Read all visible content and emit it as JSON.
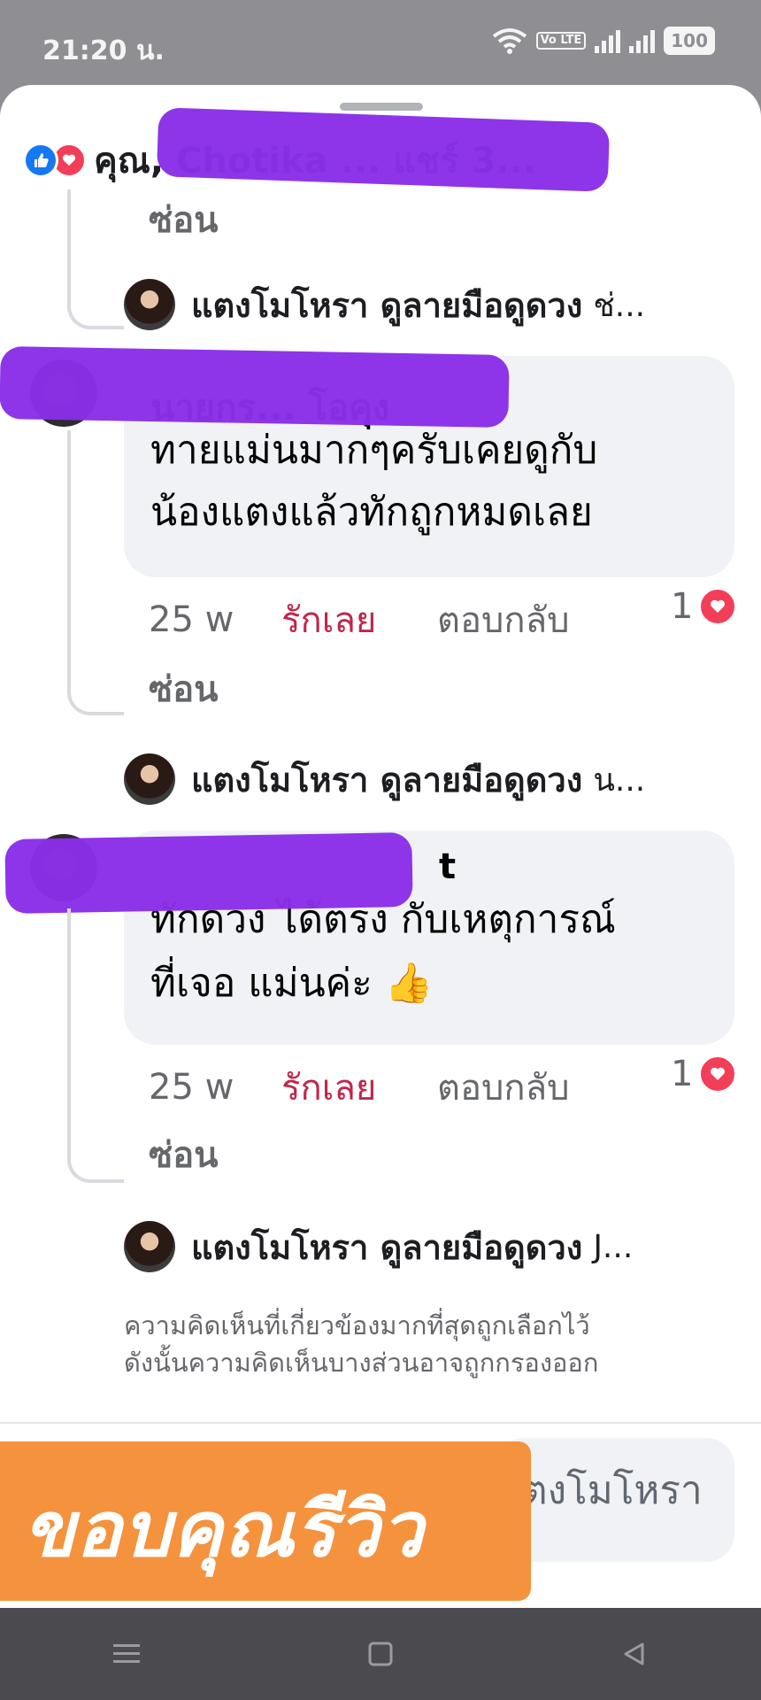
{
  "status": {
    "time": "21:20 น.",
    "network_label": "Vo LTE",
    "battery": "100"
  },
  "header": {
    "reactors_text": "คุณ, Chotika ... แชร์ 3..."
  },
  "thread": {
    "hide_label": "ซ่อน",
    "replies": [
      {
        "name": "แตงโมโหรา ดูลายมือดูดวง",
        "snippet": "ช่..."
      },
      {
        "name": "แตงโมโหรา ดูลายมือดูดวง",
        "snippet": "น..."
      },
      {
        "name": "แตงโมโหรา ดูลายมือดูดวง",
        "snippet": "J..."
      }
    ],
    "comments": [
      {
        "author": "นายกร... โอคุง",
        "line1": "ทายแม่นมากๆครับเคยดูกับ",
        "line2": "น้องแตงแล้วทักถูกหมดเลย",
        "time": "25 w",
        "love_label": "รักเลย",
        "reply_label": "ตอบกลับ",
        "reaction_count": "1"
      },
      {
        "author": "t",
        "line1": "ทักดวง ได้ตรง กับเหตุการณ์",
        "line2": "ที่เจอ แม่นค่ะ 👍",
        "time": "25 w",
        "love_label": "รักเลย",
        "reply_label": "ตอบกลับ",
        "reaction_count": "1"
      }
    ]
  },
  "footnote": {
    "line1": "ความคิดเห็นที่เกี่ยวข้องมากที่สุดถูกเลือกไว้",
    "line2": "ดังนั้นความคิดเห็นบางส่วนอาจถูกกรองออก"
  },
  "composer": {
    "partial_text": "ตงโมโหรา"
  },
  "overlay": {
    "banner_text": "ขอบคุณรีวิว"
  },
  "colors": {
    "like_blue": "#1877f2",
    "love_red": "#f33e58",
    "love_label": "#c1264a",
    "redaction": "#8a2ee8",
    "banner": "#f5923e"
  },
  "icons": [
    "wifi-icon",
    "signal-icon",
    "battery-icon",
    "like-reaction-icon",
    "love-reaction-icon",
    "menu-icon",
    "home-icon",
    "back-icon"
  ]
}
